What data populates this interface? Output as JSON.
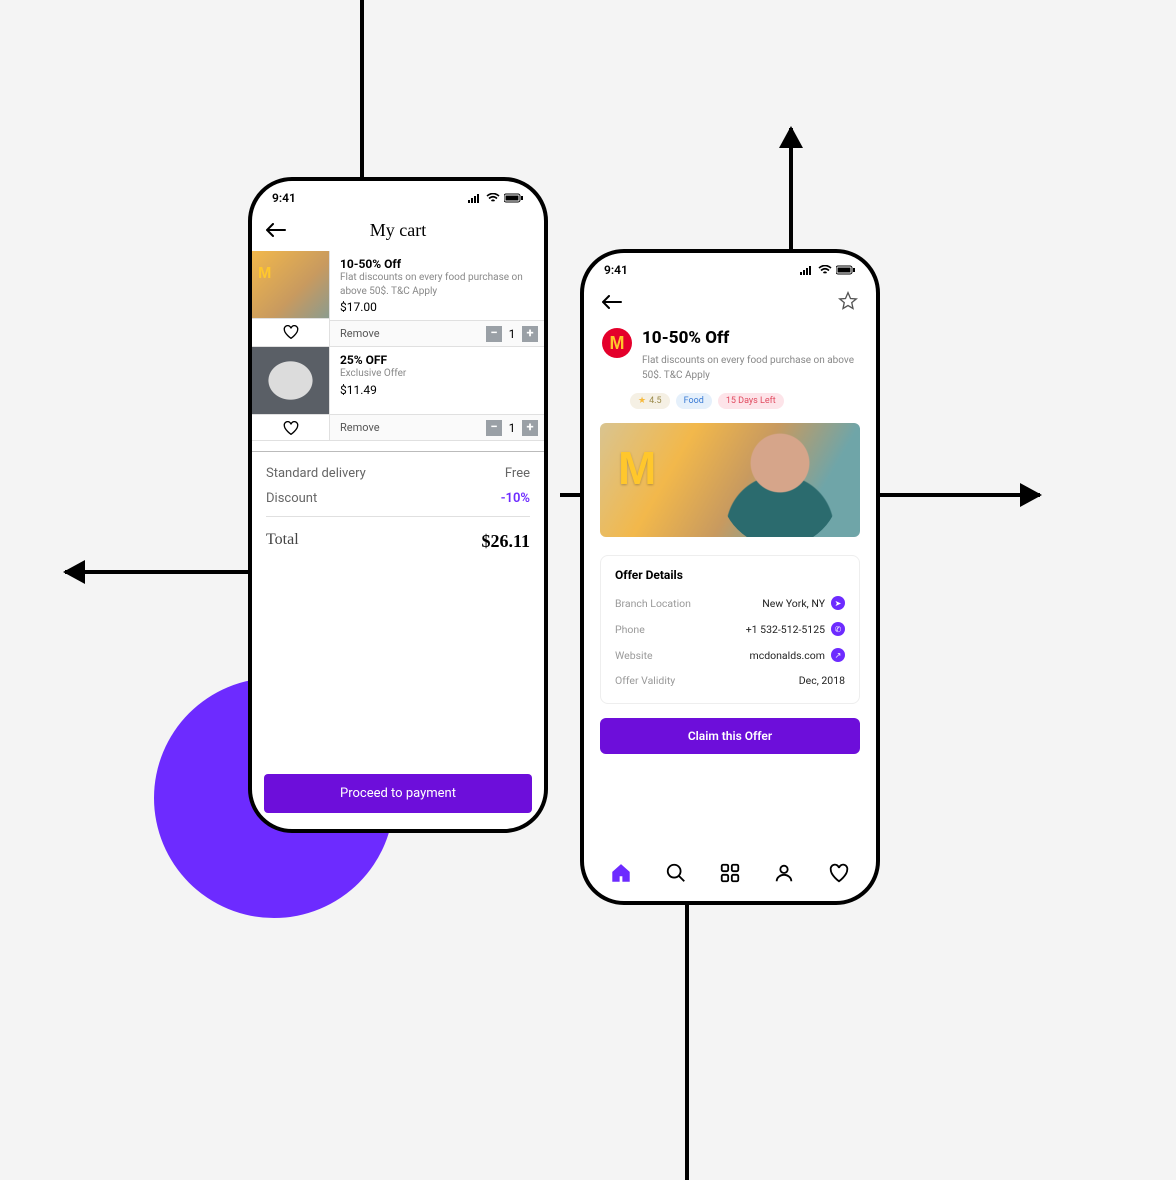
{
  "status": {
    "time": "9:41"
  },
  "cart": {
    "title": "My cart",
    "items": [
      {
        "title": "10-50% Off",
        "desc": "Flat discounts on every food purchase on above 50$. T&C Apply",
        "price": "$17.00",
        "qty": "1",
        "remove": "Remove"
      },
      {
        "title": "25% OFF",
        "desc": "Exclusive Offer",
        "price": "$11.49",
        "qty": "1",
        "remove": "Remove"
      }
    ],
    "delivery_label": "Standard delivery",
    "delivery_value": "Free",
    "discount_label": "Discount",
    "discount_value": "-10%",
    "total_label": "Total",
    "total_value": "$26.11",
    "proceed": "Proceed to payment"
  },
  "offer": {
    "title": "10-50% Off",
    "desc": "Flat discounts on every food purchase on above 50$. T&C Apply",
    "rating": "4.5",
    "category": "Food",
    "days_left": "15 Days Left",
    "details_heading": "Offer Details",
    "rows": {
      "branch_label": "Branch Location",
      "branch_value": "New York, NY",
      "phone_label": "Phone",
      "phone_value": "+1 532-512-5125",
      "website_label": "Website",
      "website_value": "mcdonalds.com",
      "validity_label": "Offer Validity",
      "validity_value": "Dec, 2018"
    },
    "claim": "Claim this Offer"
  },
  "colors": {
    "accent": "#6d0eda",
    "purple": "#6d2bff",
    "mcd_red": "#e4002b",
    "mcd_yellow": "#ffc72c"
  }
}
